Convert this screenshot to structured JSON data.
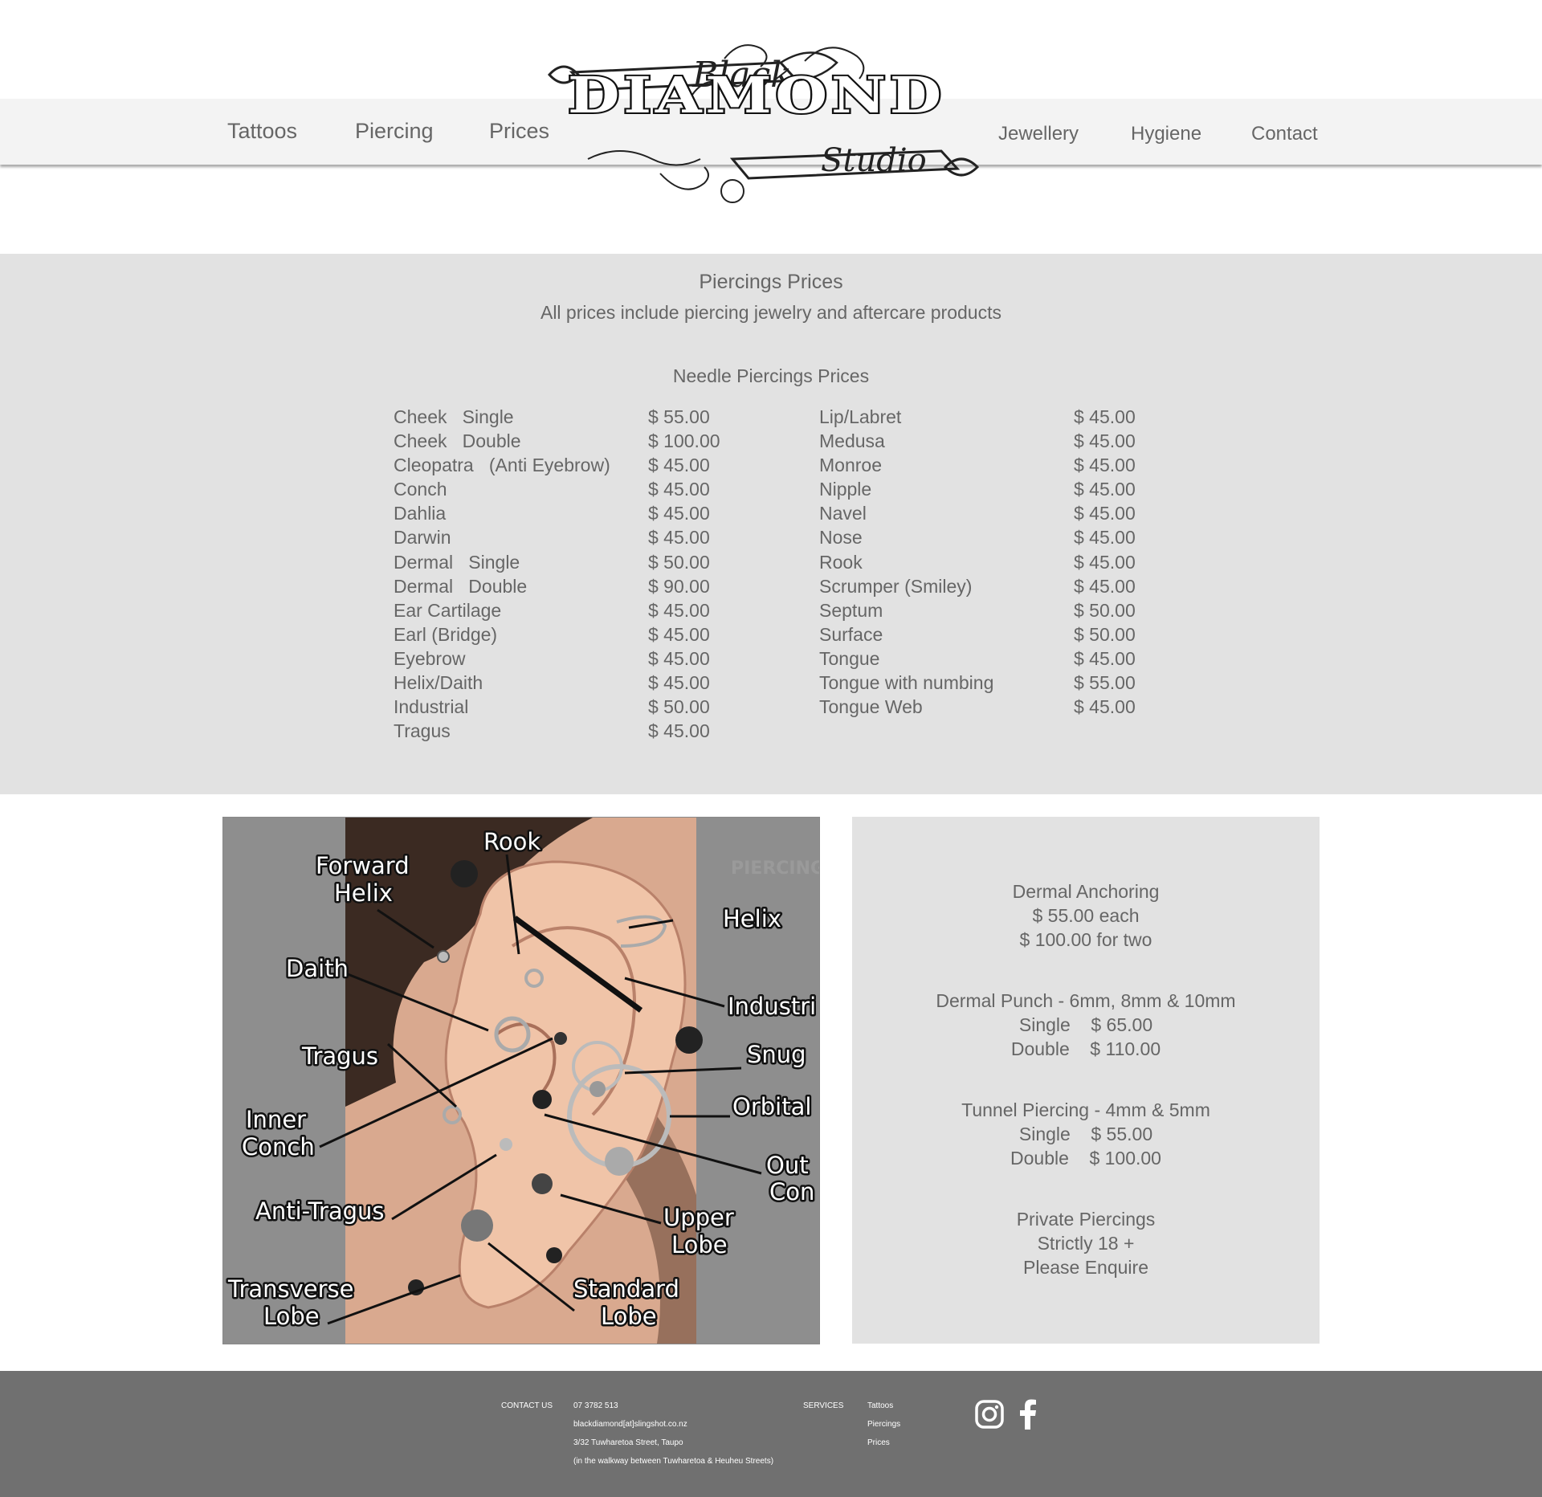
{
  "nav": {
    "left_items": [
      "Tattoos",
      "Piercing",
      "Prices"
    ],
    "right_items": [
      "Jewellery",
      "Hygiene",
      "Contact"
    ]
  },
  "logo": {
    "word1": "Black",
    "word2": "DIAMOND",
    "word3": "Studio"
  },
  "prices": {
    "title": "Piercings Prices",
    "subtitle": "All prices include piercing jewelry and aftercare products",
    "needle_title": "Needle Piercings Prices",
    "left": [
      {
        "name": "Cheek   Single",
        "price": "$ 55.00"
      },
      {
        "name": "Cheek   Double",
        "price": "$ 100.00"
      },
      {
        "name": "Cleopatra   (Anti Eyebrow)",
        "price": "$ 45.00"
      },
      {
        "name": "Conch",
        "price": "$ 45.00"
      },
      {
        "name": "Dahlia",
        "price": "$ 45.00"
      },
      {
        "name": "Darwin",
        "price": "$ 45.00"
      },
      {
        "name": "Dermal   Single",
        "price": "$ 50.00"
      },
      {
        "name": "Dermal   Double",
        "price": "$ 90.00"
      },
      {
        "name": "Ear Cartilage",
        "price": "$ 45.00"
      },
      {
        "name": "Earl (Bridge)",
        "price": "$ 45.00"
      },
      {
        "name": "Eyebrow",
        "price": "$ 45.00"
      },
      {
        "name": "Helix/Daith",
        "price": "$ 45.00"
      },
      {
        "name": "Industrial",
        "price": "$ 50.00"
      },
      {
        "name": "Tragus",
        "price": "$ 45.00"
      }
    ],
    "right": [
      {
        "name": "Lip/Labret",
        "price": "$ 45.00"
      },
      {
        "name": "Medusa",
        "price": "$ 45.00"
      },
      {
        "name": "Monroe",
        "price": "$ 45.00"
      },
      {
        "name": "Nipple",
        "price": "$ 45.00"
      },
      {
        "name": "Navel",
        "price": "$ 45.00"
      },
      {
        "name": "Nose",
        "price": "$ 45.00"
      },
      {
        "name": "Rook",
        "price": "$ 45.00"
      },
      {
        "name": "Scrumper (Smiley)",
        "price": "$ 45.00"
      },
      {
        "name": "Septum",
        "price": "$ 50.00"
      },
      {
        "name": "Surface",
        "price": "$ 50.00"
      },
      {
        "name": "Tongue",
        "price": "$ 45.00"
      },
      {
        "name": "Tongue with numbing",
        "price": "$ 55.00"
      },
      {
        "name": "Tongue Web",
        "price": "$ 45.00"
      }
    ]
  },
  "diagram": {
    "watermark": "PIERCING",
    "labels": {
      "rook": "Rook",
      "forward_helix": [
        "Forward",
        "Helix"
      ],
      "helix": "Helix",
      "daith": "Daith",
      "industrial": "Industri",
      "tragus": "Tragus",
      "snug": "Snug",
      "inner_conch": [
        "Inner",
        "Conch"
      ],
      "orbital": "Orbital",
      "outer_conch": [
        "Out",
        "Con"
      ],
      "anti_tragus": "Anti-Tragus",
      "upper_lobe": [
        "Upper",
        "Lobe"
      ],
      "transverse_lobe": [
        "Transverse",
        "Lobe"
      ],
      "standard_lobe": [
        "Standard",
        "Lobe"
      ]
    }
  },
  "info": {
    "dermal_anchoring": [
      "Dermal Anchoring",
      "$ 55.00 each",
      "$ 100.00 for two"
    ],
    "dermal_punch": [
      "Dermal Punch - 6mm, 8mm & 10mm",
      "Single    $ 65.00",
      "Double    $ 110.00"
    ],
    "tunnel": [
      "Tunnel Piercing - 4mm & 5mm",
      "Single    $ 55.00",
      "Double    $ 100.00"
    ],
    "private": [
      "Private Piercings",
      "Strictly 18 +",
      "Please Enquire"
    ]
  },
  "footer": {
    "contact_heading": "CONTACT US",
    "phone": "07 3782 513",
    "email": "blackdiamond[at]slingshot.co.nz",
    "address": "3/32 Tuwharetoa Street, Taupo",
    "address_note": "(in the walkway between Tuwharetoa & Heuheu Streets)",
    "services_heading": "SERVICES",
    "services": [
      "Tattoos",
      "Piercings",
      "Prices"
    ],
    "social_icons": [
      "instagram-icon",
      "facebook-icon"
    ]
  },
  "colors": {
    "nav_bg": "#f3f3f3",
    "section_bg": "#e2e2e2",
    "footer_bg": "#707070",
    "text": "#666666"
  }
}
